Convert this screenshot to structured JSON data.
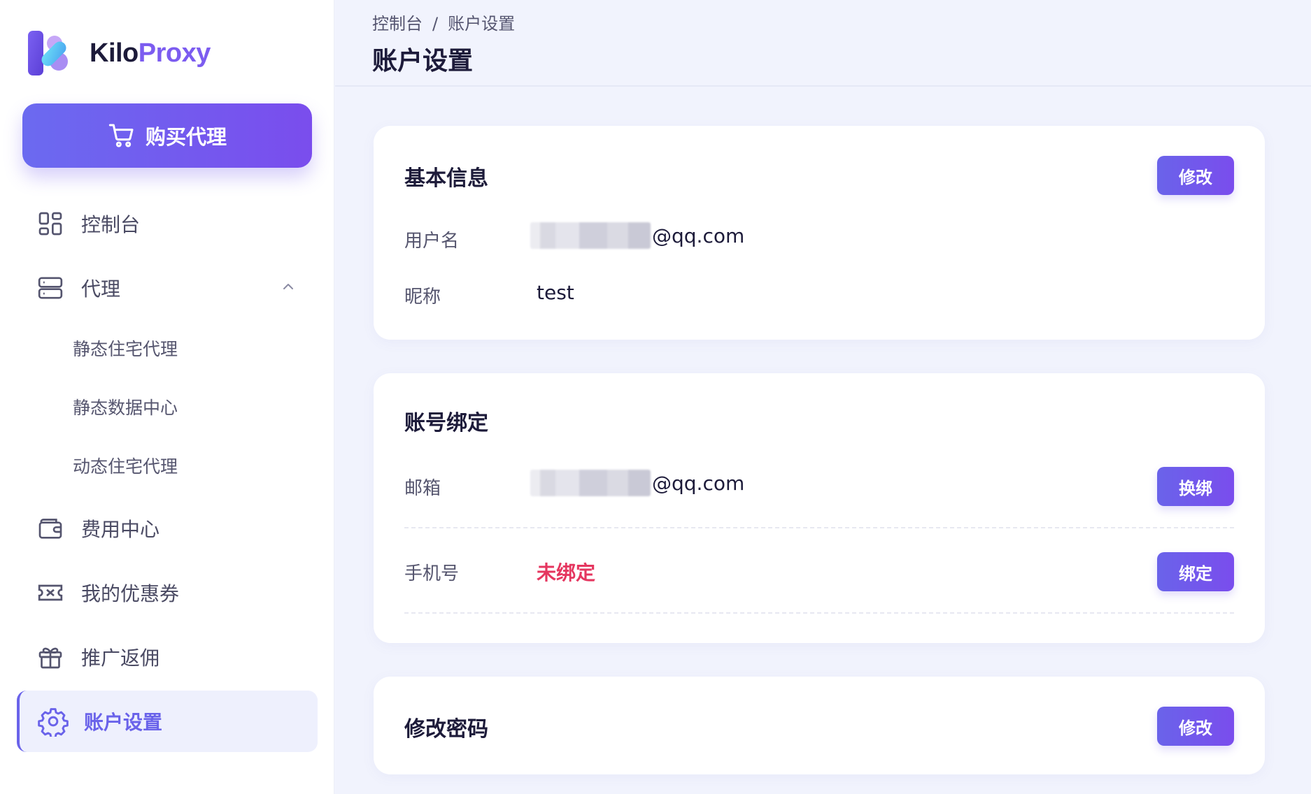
{
  "brand": {
    "name_part1": "Kilo",
    "name_part2": "Proxy",
    "colors": {
      "primary": "#6a63ea",
      "accent": "#7a4ded",
      "danger": "#e5365f"
    }
  },
  "sidebar": {
    "buy_button": {
      "label": "购买代理",
      "icon": "cart-icon"
    },
    "items": [
      {
        "label": "控制台",
        "icon": "dashboard-icon"
      },
      {
        "label": "代理",
        "icon": "server-icon",
        "expanded": true,
        "children": [
          "静态住宅代理",
          "静态数据中心",
          "动态住宅代理"
        ]
      },
      {
        "label": "费用中心",
        "icon": "wallet-icon"
      },
      {
        "label": "我的优惠券",
        "icon": "ticket-icon"
      },
      {
        "label": "推广返佣",
        "icon": "gift-icon"
      },
      {
        "label": "账户设置",
        "icon": "gear-icon",
        "active": true
      }
    ]
  },
  "header": {
    "breadcrumb": [
      "控制台",
      "账户设置"
    ],
    "breadcrumb_separator": "/",
    "title": "账户设置"
  },
  "cards": {
    "basic_info": {
      "title": "基本信息",
      "edit_label": "修改",
      "rows": [
        {
          "label": "用户名",
          "value": "@qq.com",
          "masked": true
        },
        {
          "label": "昵称",
          "value": "test"
        }
      ]
    },
    "binding": {
      "title": "账号绑定",
      "rows": [
        {
          "label": "邮箱",
          "value": "@qq.com",
          "masked": true,
          "action_label": "换绑"
        },
        {
          "label": "手机号",
          "value": "未绑定",
          "action_label": "绑定"
        }
      ]
    },
    "password": {
      "title": "修改密码",
      "edit_label": "修改"
    }
  }
}
